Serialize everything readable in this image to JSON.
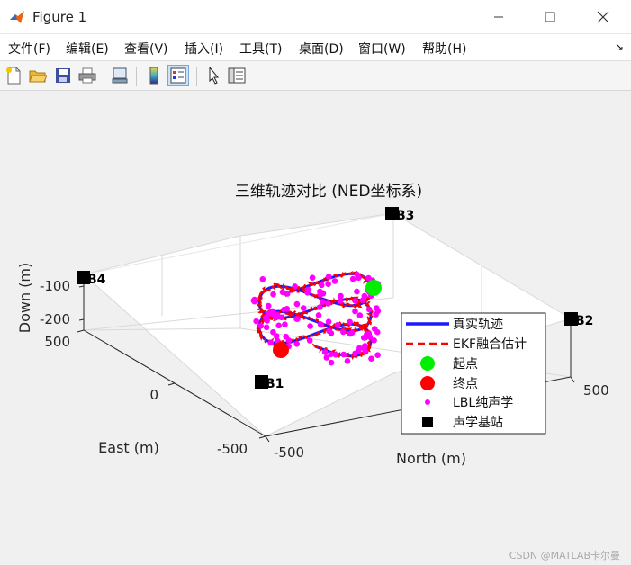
{
  "window": {
    "title": "Figure 1"
  },
  "menu": [
    "文件(F)",
    "编辑(E)",
    "查看(V)",
    "插入(I)",
    "工具(T)",
    "桌面(D)",
    "窗口(W)",
    "帮助(H)"
  ],
  "toolbar": [
    "new-figure-icon",
    "open-file-icon",
    "save-icon",
    "print-icon",
    "link-plot-icon",
    "colorbar-icon",
    "legend-icon",
    "pointer-icon",
    "property-inspector-icon"
  ],
  "colors": {
    "true_traj": "#1a1aff",
    "ekf": "#ff0000",
    "start": "#00ee00",
    "end": "#ff0000",
    "lbl": "#ff00ff",
    "beacon": "#000000"
  },
  "chart_data": {
    "type": "scatter3d",
    "title": "三维轨迹对比 (NED坐标系)",
    "xlabel": "North (m)",
    "ylabel": "East (m)",
    "zlabel": "Down (m)",
    "x_ticks": [
      "-500",
      "500"
    ],
    "y_ticks": [
      "500",
      "0",
      "-500"
    ],
    "z_ticks": [
      "-100",
      "-200"
    ],
    "beacons": [
      "B1",
      "B2",
      "B3",
      "B4"
    ],
    "legend": [
      "真实轨迹",
      "EKF融合估计",
      "起点",
      "终点",
      "LBL纯声学",
      "声学基站"
    ],
    "legend_position": "east"
  },
  "watermark": "CSDN @MATLAB卡尔曼"
}
